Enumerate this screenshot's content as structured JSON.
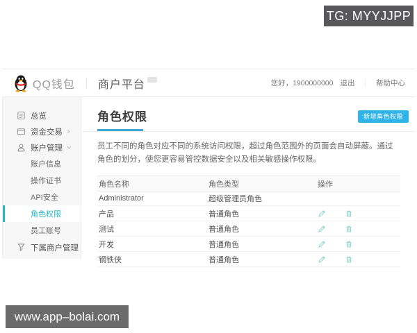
{
  "overlays": {
    "tg_badge": "TG: MYYJJPP",
    "watermark": "www.app–bolai.com"
  },
  "header": {
    "logo_text": "QQ钱包",
    "divider": "｜",
    "platform": "商户平台",
    "greeting": "您好，1900000000",
    "logout": "退出",
    "links_divider": "｜",
    "help": "帮助中心"
  },
  "sidebar": {
    "items": [
      {
        "label": "总览",
        "icon": "overview-icon"
      },
      {
        "label": "资金交易",
        "icon": "funds-icon",
        "chevron": "right"
      },
      {
        "label": "账户管理",
        "icon": "account-icon",
        "chevron": "down"
      }
    ],
    "submenu": [
      "账户信息",
      "操作证书",
      "API安全",
      "角色权限",
      "员工账号"
    ],
    "active_item": "角色权限",
    "bottom_item": "下属商户管理"
  },
  "main": {
    "title": "角色权限",
    "add_button": "新增角色权限",
    "description": "员工不同的角色对应不同的系统访问权限，超过角色范围外的页面会自动屏蔽。通过角色的划分，使您更容易管控数据安全以及相关敏感操作权限。",
    "table": {
      "headers": [
        "角色名称",
        "角色类型",
        "操作"
      ],
      "rows": [
        {
          "name": "Administrator",
          "type": "超级管理员角色"
        },
        {
          "name": "产品",
          "type": "普通角色"
        },
        {
          "name": "测试",
          "type": "普通角色"
        },
        {
          "name": "开发",
          "type": "普通角色"
        },
        {
          "name": "钢铁侠",
          "type": "普通角色"
        }
      ]
    }
  },
  "icons": {
    "edit": "pencil-outline",
    "delete": "trash-outline",
    "logo": "qq-penguin"
  },
  "colors": {
    "accent_teal": "#2ab5c2",
    "button_blue": "#2fb3e8",
    "title_underline": "#3aa9d4",
    "action_icon_teal": "#87d4ca",
    "badge_gray": "#58585b",
    "watermark_gray": "#6b6b6b",
    "sidebar_bg": "#f7f7f7"
  }
}
